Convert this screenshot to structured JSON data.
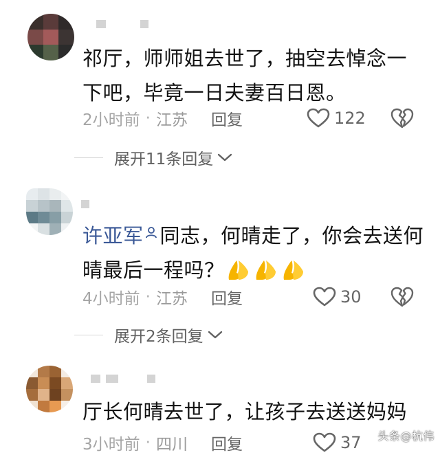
{
  "comments": [
    {
      "body": "祁厅，师师姐去世了，抽空去悼念一下吧，毕竟一日夫妻百日恩。",
      "time": "2小时前",
      "location": "江苏",
      "reply_label": "回复",
      "likes": "122",
      "expand_label": "展开11条回复"
    },
    {
      "mention": "许亚军",
      "body": "同志，何晴走了，你会去送何晴最后一程吗？",
      "time": "4小时前",
      "location": "江苏",
      "reply_label": "回复",
      "likes": "30",
      "expand_label": "展开2条回复"
    },
    {
      "body": "厅长何晴去世了，让孩子去送送妈妈",
      "time": "3小时前",
      "location": "四川",
      "reply_label": "回复",
      "likes": "37"
    }
  ],
  "icons": {
    "like": "heart-outline-icon",
    "dislike": "broken-heart-icon",
    "expand": "chevron-down-icon",
    "mention": "person-icon",
    "emoji": "folded-hands-emoji-icon"
  },
  "colors": {
    "text": "#121212",
    "meta": "#9b9b9b",
    "mention": "#3b5997",
    "emoji": "#f6b400"
  },
  "watermark": "头条@杭伟"
}
